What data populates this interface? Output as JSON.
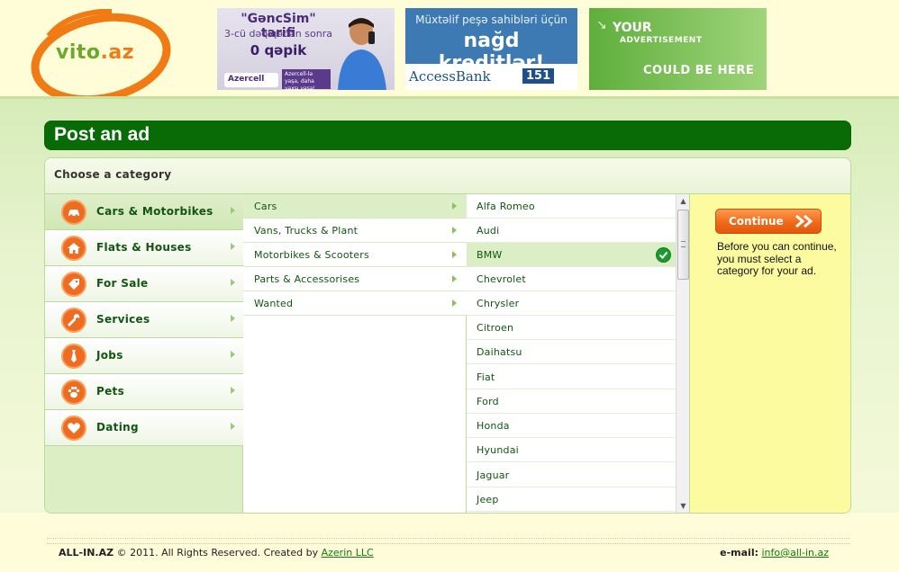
{
  "header": {
    "logo": {
      "text_main": "vito",
      "text_domain": ".az"
    },
    "banners": [
      {
        "line1": "\"GəncSim\" tarifi",
        "line2": "3-cü dəqiqədən sonra",
        "line3": "0 qəpik",
        "brand": "Azercell",
        "slogan": "Azercell-lə yaşa, daha yaxşı yaşa!"
      },
      {
        "line1": "Müxtəlif peşə sahibləri üçün",
        "line2": "nağd kreditlər!",
        "bank": "AccessBank",
        "number": "151"
      },
      {
        "line1": "YOUR",
        "line2": "ADVERTISEMENT",
        "line3": "COULD BE HERE"
      }
    ]
  },
  "page": {
    "title": "Post an ad",
    "section_label": "Choose a category"
  },
  "categories": [
    {
      "label": "Cars & Motorbikes",
      "icon": "car-icon",
      "selected": true
    },
    {
      "label": "Flats & Houses",
      "icon": "house-icon",
      "selected": false
    },
    {
      "label": "For Sale",
      "icon": "tag-icon",
      "selected": false
    },
    {
      "label": "Services",
      "icon": "wrench-icon",
      "selected": false
    },
    {
      "label": "Jobs",
      "icon": "tie-icon",
      "selected": false
    },
    {
      "label": "Pets",
      "icon": "paw-icon",
      "selected": false
    },
    {
      "label": "Dating",
      "icon": "heart-icon",
      "selected": false
    }
  ],
  "subcategories": [
    {
      "label": "Cars",
      "selected": true
    },
    {
      "label": "Vans, Trucks & Plant",
      "selected": false
    },
    {
      "label": "Motorbikes & Scooters",
      "selected": false
    },
    {
      "label": "Parts & Accessorises",
      "selected": false
    },
    {
      "label": "Wanted",
      "selected": false
    }
  ],
  "brands": [
    {
      "label": "Alfa Romeo",
      "selected": false
    },
    {
      "label": "Audi",
      "selected": false
    },
    {
      "label": "BMW",
      "selected": true
    },
    {
      "label": "Chevrolet",
      "selected": false
    },
    {
      "label": "Chrysler",
      "selected": false
    },
    {
      "label": "Citroen",
      "selected": false
    },
    {
      "label": "Daihatsu",
      "selected": false
    },
    {
      "label": "Fiat",
      "selected": false
    },
    {
      "label": "Ford",
      "selected": false
    },
    {
      "label": "Honda",
      "selected": false
    },
    {
      "label": "Hyundai",
      "selected": false
    },
    {
      "label": "Jaguar",
      "selected": false
    },
    {
      "label": "Jeep",
      "selected": false
    }
  ],
  "action": {
    "continue_label": "Continue",
    "hint": "Before you can continue, you must select a category for your ad."
  },
  "footer": {
    "site": "ALL-IN.AZ",
    "copyright_symbol": "©",
    "copyright_text": "2011. All Rights Reserved. Created by",
    "creator": "Azerin LLC",
    "email_label": "e-mail:",
    "email": "info@all-in.az"
  },
  "colors": {
    "accent_green": "#096b06",
    "orange": "#ee6c22",
    "hint_panel": "#fdfba0",
    "selected_row": "#dbeec5"
  }
}
